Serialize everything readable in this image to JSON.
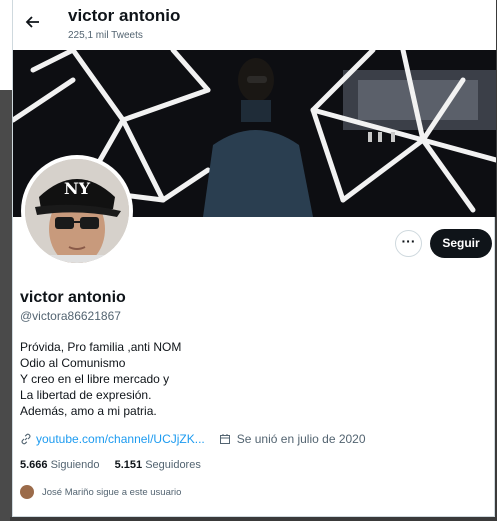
{
  "header": {
    "back_icon": "arrow-left-icon",
    "title": "victor antonio",
    "subtitle": "225,1 mil Tweets"
  },
  "actions": {
    "more_label": "···",
    "follow_label": "Seguir"
  },
  "profile": {
    "name": "victor antonio",
    "handle": "@victora86621867",
    "bio": [
      "Próvida, Pro familia ,anti NOM",
      "Odio al Comunismo",
      "Y creo en el libre mercado y",
      "La libertad de expresión.",
      "Además, amo a mi patria."
    ],
    "link": "youtube.com/channel/UCJjZK...",
    "joined": "Se unió en julio de 2020",
    "following_count": "5.666",
    "following_label": "Siguiendo",
    "followers_count": "5.151",
    "followers_label": "Seguidores",
    "followed_by": "José Mariño sigue a este usuario"
  },
  "colors": {
    "accent": "#1d9bf0",
    "text": "#0f1419",
    "secondary": "#536471"
  }
}
